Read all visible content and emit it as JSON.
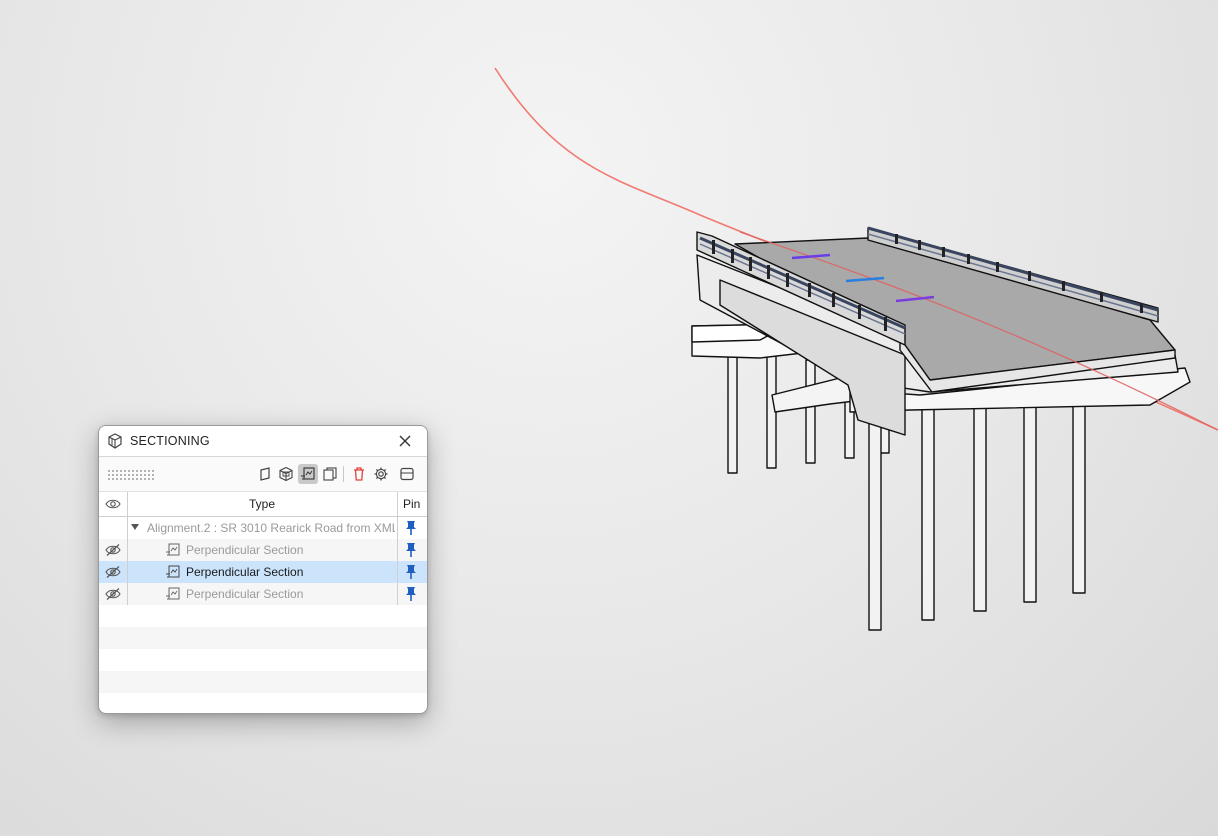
{
  "panel": {
    "title": "SECTIONING",
    "app_icon": "sectioning-cube-icon",
    "close_icon": "close-icon"
  },
  "toolbar": {
    "buttons": [
      {
        "icon": "plane-section-icon",
        "active": false
      },
      {
        "icon": "box-section-icon",
        "active": false
      },
      {
        "icon": "perpendicular-section-icon",
        "active": true
      },
      {
        "icon": "parallel-section-icon",
        "active": false
      },
      {
        "icon": "delete-icon",
        "active": false,
        "color": "#e0403a"
      },
      {
        "icon": "gear-icon",
        "active": false
      },
      {
        "icon": "panel-layout-icon",
        "active": false
      }
    ]
  },
  "table": {
    "headers": {
      "visibility_icon": "eye-icon",
      "type": "Type",
      "pin": "Pin"
    },
    "rows": [
      {
        "level": 0,
        "label": "Alignment.2 : SR 3010 Rearick Road from XML",
        "hidden": false,
        "selected": false,
        "pinned": true
      },
      {
        "level": 1,
        "label": "Perpendicular Section",
        "hidden": true,
        "selected": false,
        "pinned": true
      },
      {
        "level": 1,
        "label": "Perpendicular Section",
        "hidden": true,
        "selected": true,
        "pinned": true
      },
      {
        "level": 1,
        "label": "Perpendicular Section",
        "hidden": true,
        "selected": false,
        "pinned": true
      }
    ]
  },
  "colors": {
    "selection": "#cce4fb",
    "pin": "#1f5fbf",
    "alignment_line": "#f07070",
    "section_marks": [
      "#6a3de8",
      "#2a7fe0",
      "#7a3de0"
    ],
    "deck": "#a9a9a9"
  }
}
